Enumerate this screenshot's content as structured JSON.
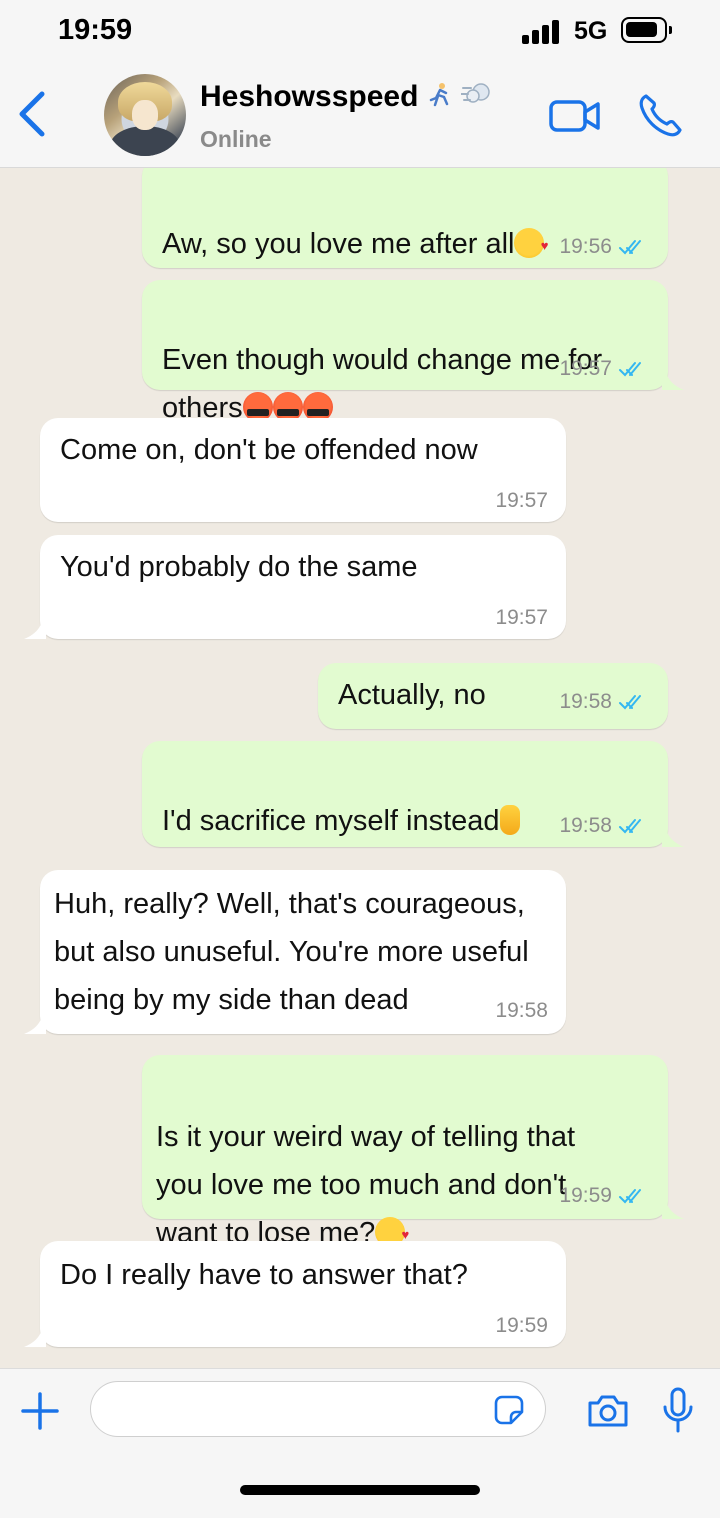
{
  "status_bar": {
    "time": "19:59",
    "network": "5G",
    "battery_icon": "battery-icon",
    "signal_icon": "signal-bars-icon"
  },
  "header": {
    "back_icon": "chevron-left-icon",
    "contact_name": "Heshowsspeed",
    "name_emojis": [
      "runner-emoji",
      "dash-emoji"
    ],
    "status": "Online",
    "video_icon": "video-camera-icon",
    "call_icon": "phone-icon",
    "accent_color": "#1a73e8"
  },
  "messages": [
    {
      "direction": "out",
      "text": "Aw, so you love me after all",
      "emoji": "smiling-face-with-hearts",
      "time": "19:56",
      "read": true
    },
    {
      "direction": "out",
      "text": "Even though would change me for\nothers",
      "emoji": "face-with-symbols-on-mouth x3",
      "time": "19:57",
      "read": true
    },
    {
      "direction": "in",
      "text": "Come on, don't be offended now",
      "time": "19:57"
    },
    {
      "direction": "in",
      "text": "You'd probably do the same",
      "time": "19:57"
    },
    {
      "direction": "out",
      "text": "Actually, no",
      "time": "19:58",
      "read": true
    },
    {
      "direction": "out",
      "text": "I'd sacrifice myself instead",
      "emoji": "index-pointing-up",
      "time": "19:58",
      "read": true
    },
    {
      "direction": "in",
      "text": "Huh, really? Well, that's courageous,\nbut also unuseful. You're more useful\nbeing by my side than dead",
      "time": "19:58"
    },
    {
      "direction": "out",
      "text": "Is it your weird way of telling that\nyou love me too much and don't\nwant to lose me?",
      "emoji": "smiling-face-with-hearts",
      "time": "19:59",
      "read": true
    },
    {
      "direction": "in",
      "text": "Do I really have to answer that?",
      "time": "19:59"
    }
  ],
  "input_bar": {
    "plus_icon": "plus-icon",
    "placeholder": "",
    "sticker_icon": "sticker-icon",
    "camera_icon": "camera-icon",
    "mic_icon": "microphone-icon"
  },
  "colors": {
    "chat_background": "#efeae2",
    "incoming_bubble": "#ffffff",
    "outgoing_bubble": "#e2fbd0",
    "read_ticks": "#34b7f1",
    "bar_background": "#f6f6f6"
  }
}
